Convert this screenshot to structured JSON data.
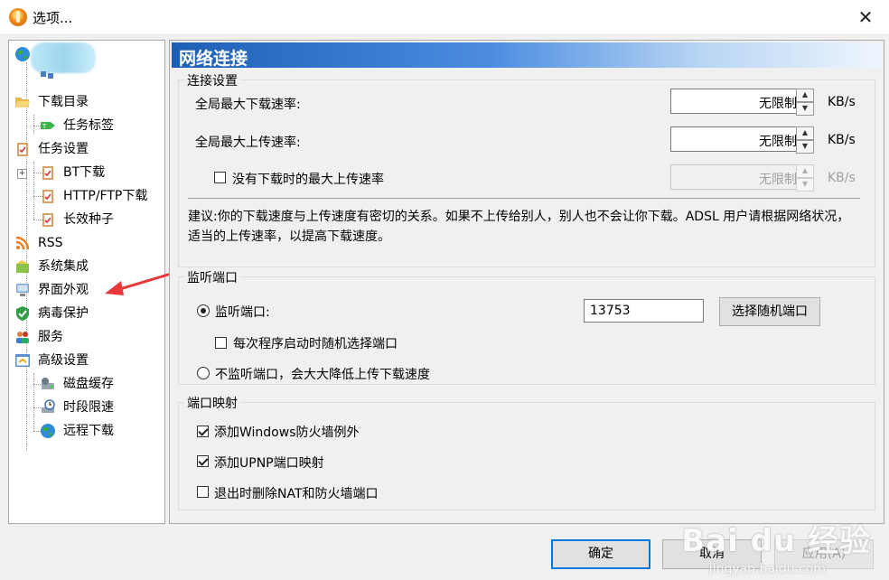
{
  "window": {
    "title": "选项...",
    "close_glyph": "✕"
  },
  "sidebar": {
    "items": [
      {
        "label": "下载目录",
        "icon": "folder-open-icon"
      },
      {
        "label": "任务标签",
        "icon": "tag-icon"
      },
      {
        "label": "任务设置",
        "icon": "clipboard-icon"
      },
      {
        "label": "BT下载",
        "icon": "clipboard-icon"
      },
      {
        "label": "HTTP/FTP下载",
        "icon": "clipboard-icon"
      },
      {
        "label": "长效种子",
        "icon": "clipboard-icon"
      },
      {
        "label": "RSS",
        "icon": "rss-icon"
      },
      {
        "label": "系统集成",
        "icon": "puzzle-icon"
      },
      {
        "label": "界面外观",
        "icon": "monitor-icon"
      },
      {
        "label": "病毒保护",
        "icon": "shield-icon"
      },
      {
        "label": "服务",
        "icon": "users-icon"
      },
      {
        "label": "高级设置",
        "icon": "settings-window-icon"
      },
      {
        "label": "磁盘缓存",
        "icon": "disk-icon"
      },
      {
        "label": "时段限速",
        "icon": "clock-icon"
      },
      {
        "label": "远程下载",
        "icon": "globe-icon"
      }
    ]
  },
  "panel": {
    "title": "网络连接",
    "connection": {
      "group_title": "连接设置",
      "max_download_label": "全局最大下载速率:",
      "max_download_value": "无限制",
      "max_upload_label": "全局最大上传速率:",
      "max_upload_value": "无限制",
      "idle_upload_label": "没有下载时的最大上传速率",
      "idle_upload_value": "无限制",
      "unit": "KB/s",
      "tip": "建议:你的下载速度与上传速度有密切的关系。如果不上传给别人，别人也不会让你下载。ADSL 用户请根据网络状况，适当的上传速率，以提高下载速度。"
    },
    "listen": {
      "group_title": "监听端口",
      "listen_label": "监听端口:",
      "port_value": "13753",
      "random_button": "选择随机端口",
      "random_each_start_label": "每次程序启动时随机选择端口",
      "no_listen_label": "不监听端口，会大大降低上传下载速度"
    },
    "mapping": {
      "group_title": "端口映射",
      "firewall_label": "添加Windows防火墙例外",
      "upnp_label": "添加UPNP端口映射",
      "remove_on_exit_label": "退出时删除NAT和防火墙端口"
    }
  },
  "buttons": {
    "ok": "确定",
    "cancel": "取消",
    "apply": "应用(A)"
  },
  "watermark": {
    "main": "Bai du 经验",
    "sub": "jingyan.baidu.com"
  },
  "colors": {
    "header_start": "#1c5fb5",
    "accent": "#0078d7",
    "arrow": "#e8373b"
  }
}
